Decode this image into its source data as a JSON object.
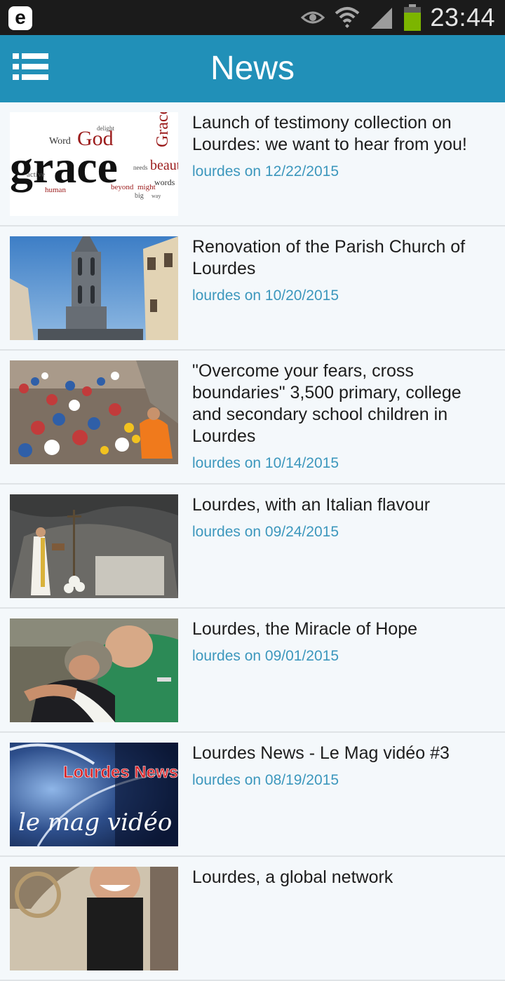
{
  "status_bar": {
    "app_icon_letter": "e",
    "time": "23:44",
    "icons": [
      "eye-icon",
      "wifi-icon",
      "signal-icon",
      "battery-icon"
    ],
    "battery_color": "#7cb500"
  },
  "app_bar": {
    "title": "News",
    "menu_icon": "menu-list-icon",
    "color": "#2190b8"
  },
  "news": [
    {
      "title": "Launch of testimony collection on Lourdes: we want to hear from you!",
      "meta": "lourdes on 12/22/2015",
      "thumb_words": [
        "grace",
        "God",
        "Grace",
        "Word",
        "active",
        "human",
        "beyond",
        "beaut",
        "needs",
        "might",
        "words",
        "delight",
        "big",
        "way"
      ]
    },
    {
      "title": "Renovation of the Parish Church of Lourdes",
      "meta": "lourdes on 10/20/2015"
    },
    {
      "title": "\"Overcome your fears, cross boundaries\" 3,500 primary, college and secondary school children in Lourdes",
      "meta": "lourdes on 10/14/2015"
    },
    {
      "title": "Lourdes, with an Italian flavour",
      "meta": "lourdes on 09/24/2015"
    },
    {
      "title": "Lourdes, the Miracle of Hope",
      "meta": "lourdes on 09/01/2015"
    },
    {
      "title": "Lourdes News - Le Mag vidéo #3",
      "meta": "lourdes on 08/19/2015",
      "thumb_text": [
        "Lourdes News",
        "le mag vidéo"
      ]
    },
    {
      "title": "Lourdes, a global network",
      "meta": ""
    }
  ]
}
